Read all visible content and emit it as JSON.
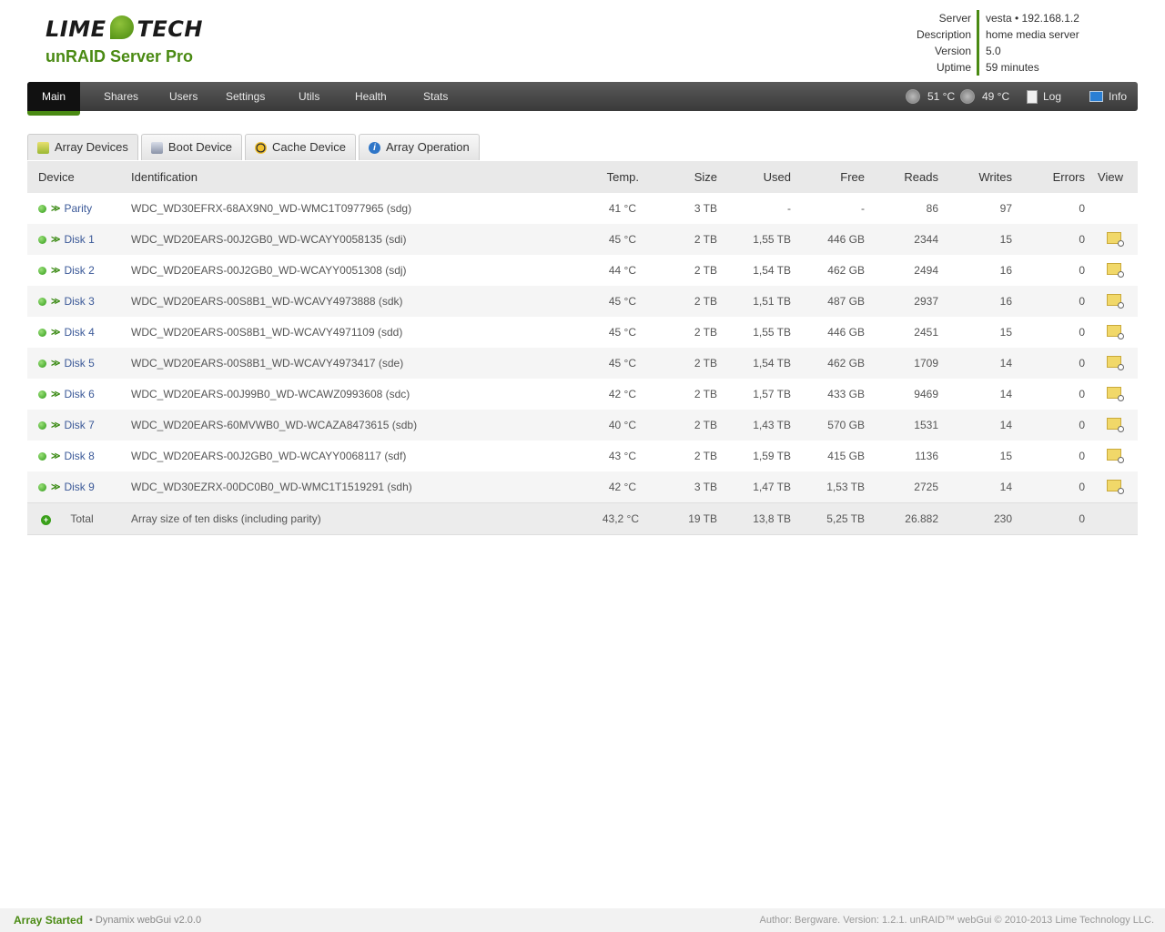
{
  "brand": {
    "logo_left": "LIME",
    "logo_right": "TECH",
    "product": "unRAID Server Pro"
  },
  "server_info": [
    {
      "label": "Server",
      "value": "vesta • 192.168.1.2"
    },
    {
      "label": "Description",
      "value": "home media server"
    },
    {
      "label": "Version",
      "value": "5.0"
    },
    {
      "label": "Uptime",
      "value": "59 minutes"
    }
  ],
  "nav": {
    "items": [
      "Main",
      "Shares",
      "Users",
      "Settings",
      "Utils",
      "Health",
      "Stats"
    ],
    "active": "Main",
    "temp1": "51 °C",
    "temp2": "49 °C",
    "log": "Log",
    "info": "Info"
  },
  "tabs": [
    "Array Devices",
    "Boot Device",
    "Cache Device",
    "Array Operation"
  ],
  "table": {
    "headers": [
      "Device",
      "Identification",
      "Temp.",
      "Size",
      "Used",
      "Free",
      "Reads",
      "Writes",
      "Errors",
      "View"
    ],
    "rows": [
      {
        "device": "Parity",
        "id": "WDC_WD30EFRX-68AX9N0_WD-WMC1T0977965 (sdg)",
        "temp": "41 °C",
        "size": "3 TB",
        "used": "-",
        "free": "-",
        "reads": "86",
        "writes": "97",
        "errors": "0"
      },
      {
        "device": "Disk 1",
        "id": "WDC_WD20EARS-00J2GB0_WD-WCAYY0058135 (sdi)",
        "temp": "45 °C",
        "size": "2 TB",
        "used": "1,55 TB",
        "free": "446 GB",
        "reads": "2344",
        "writes": "15",
        "errors": "0"
      },
      {
        "device": "Disk 2",
        "id": "WDC_WD20EARS-00J2GB0_WD-WCAYY0051308 (sdj)",
        "temp": "44 °C",
        "size": "2 TB",
        "used": "1,54 TB",
        "free": "462 GB",
        "reads": "2494",
        "writes": "16",
        "errors": "0"
      },
      {
        "device": "Disk 3",
        "id": "WDC_WD20EARS-00S8B1_WD-WCAVY4973888 (sdk)",
        "temp": "45 °C",
        "size": "2 TB",
        "used": "1,51 TB",
        "free": "487 GB",
        "reads": "2937",
        "writes": "16",
        "errors": "0"
      },
      {
        "device": "Disk 4",
        "id": "WDC_WD20EARS-00S8B1_WD-WCAVY4971109 (sdd)",
        "temp": "45 °C",
        "size": "2 TB",
        "used": "1,55 TB",
        "free": "446 GB",
        "reads": "2451",
        "writes": "15",
        "errors": "0"
      },
      {
        "device": "Disk 5",
        "id": "WDC_WD20EARS-00S8B1_WD-WCAVY4973417 (sde)",
        "temp": "45 °C",
        "size": "2 TB",
        "used": "1,54 TB",
        "free": "462 GB",
        "reads": "1709",
        "writes": "14",
        "errors": "0"
      },
      {
        "device": "Disk 6",
        "id": "WDC_WD20EARS-00J99B0_WD-WCAWZ0993608 (sdc)",
        "temp": "42 °C",
        "size": "2 TB",
        "used": "1,57 TB",
        "free": "433 GB",
        "reads": "9469",
        "writes": "14",
        "errors": "0"
      },
      {
        "device": "Disk 7",
        "id": "WDC_WD20EARS-60MVWB0_WD-WCAZA8473615 (sdb)",
        "temp": "40 °C",
        "size": "2 TB",
        "used": "1,43 TB",
        "free": "570 GB",
        "reads": "1531",
        "writes": "14",
        "errors": "0"
      },
      {
        "device": "Disk 8",
        "id": "WDC_WD20EARS-00J2GB0_WD-WCAYY0068117 (sdf)",
        "temp": "43 °C",
        "size": "2 TB",
        "used": "1,59 TB",
        "free": "415 GB",
        "reads": "1136",
        "writes": "15",
        "errors": "0"
      },
      {
        "device": "Disk 9",
        "id": "WDC_WD30EZRX-00DC0B0_WD-WMC1T1519291 (sdh)",
        "temp": "42 °C",
        "size": "3 TB",
        "used": "1,47 TB",
        "free": "1,53 TB",
        "reads": "2725",
        "writes": "14",
        "errors": "0"
      }
    ],
    "total": {
      "device": "Total",
      "id": "Array size of ten disks (including parity)",
      "temp": "43,2 °C",
      "size": "19 TB",
      "used": "13,8 TB",
      "free": "5,25 TB",
      "reads": "26.882",
      "writes": "230",
      "errors": "0"
    }
  },
  "footer": {
    "status": "Array Started",
    "gui": "• Dynamix webGui v2.0.0",
    "credits": "Author: Bergware. Version: 1.2.1.  unRAID™ webGui © 2010-2013 Lime Technology LLC."
  }
}
